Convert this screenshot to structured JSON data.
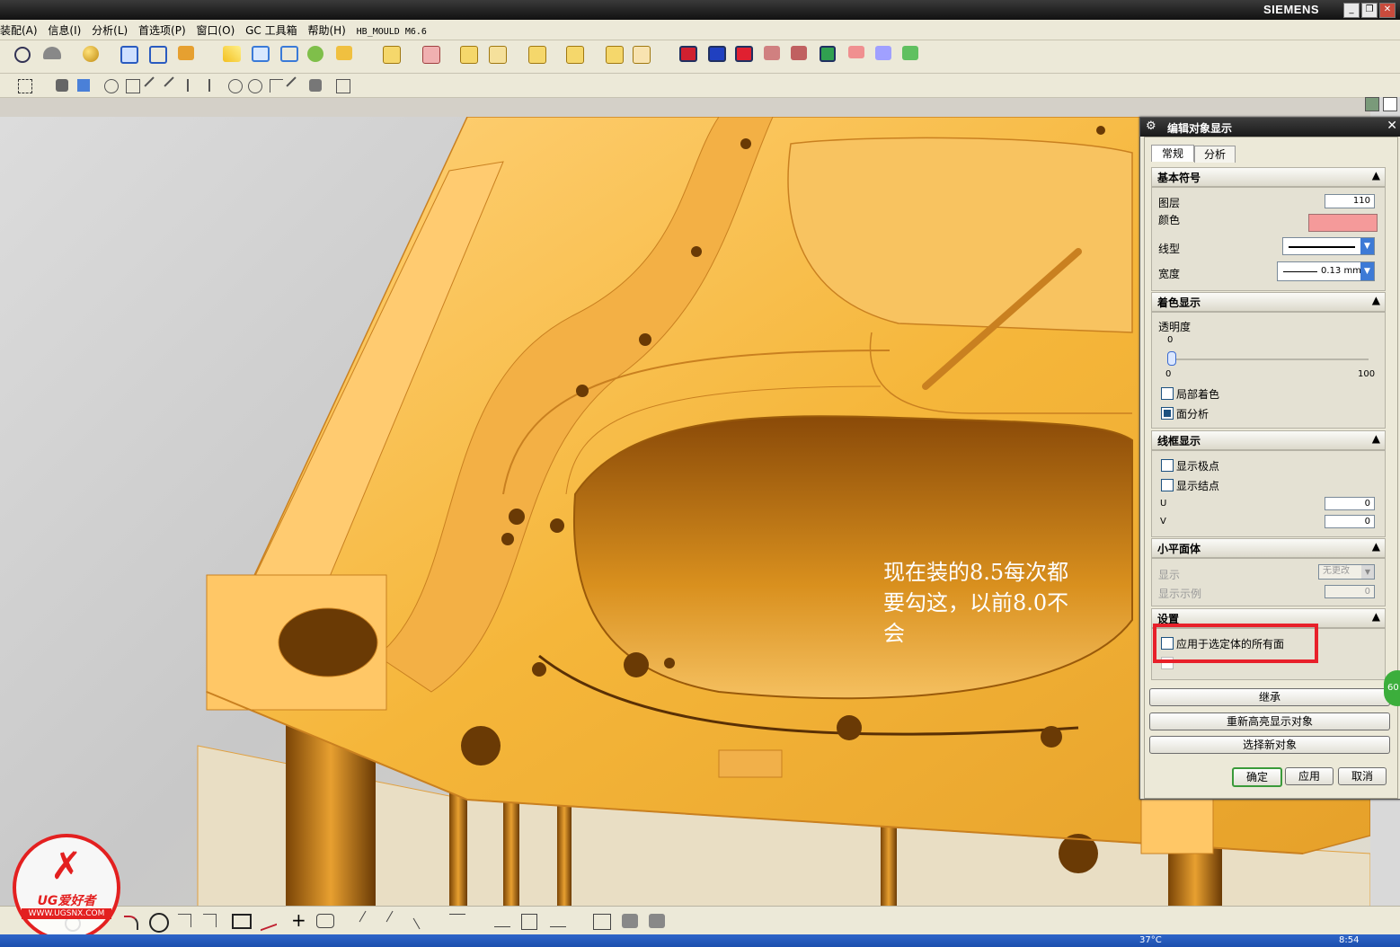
{
  "titlebar": {
    "brand": "SIEMENS"
  },
  "menu": {
    "items": [
      "装配(A)",
      "信息(I)",
      "分析(L)",
      "首选项(P)",
      "窗口(O)",
      "GC 工具箱",
      "帮助(H)",
      "HB_MOULD M6.6"
    ]
  },
  "annotation": {
    "line1": "现在装的8.5每次都",
    "line2": "要勾这，以前8.0不",
    "line3": "会"
  },
  "dialog": {
    "title": "编辑对象显示",
    "tabs": [
      "常规",
      "分析"
    ],
    "basic": {
      "header": "基本符号",
      "layer_label": "图层",
      "layer_value": "110",
      "color_label": "颜色",
      "color_value": "#f59a9a",
      "linetype_label": "线型",
      "width_label": "宽度",
      "width_value": "0.13 mm"
    },
    "shading": {
      "header": "着色显示",
      "transparency_label": "透明度",
      "transparency_value": "0",
      "slider_min": "0",
      "slider_max": "100",
      "partial_shading": "局部着色",
      "face_analysis": "面分析"
    },
    "wireframe": {
      "header": "线框显示",
      "show_poles": "显示极点",
      "show_knots": "显示结点",
      "u_label": "U",
      "u_value": "0",
      "v_label": "V",
      "v_value": "0"
    },
    "facets": {
      "header": "小平面体",
      "display_label": "显示",
      "display_value": "无更改",
      "example_label": "显示示例",
      "example_value": "0"
    },
    "settings": {
      "header": "设置",
      "apply_all_faces": "应用于选定体的所有面"
    },
    "buttons": {
      "inherit": "继承",
      "rehighlight": "重新高亮显示对象",
      "select_new": "选择新对象",
      "ok": "确定",
      "apply": "应用",
      "cancel": "取消"
    }
  },
  "watermark": {
    "brand": "UG爱好者",
    "url": "WWW.UGSNX.COM"
  },
  "side_badge": "60",
  "taskbar": {
    "temp": "37°C",
    "time": "8:54"
  },
  "colors": {
    "part": "#f6b63a",
    "part_edge": "#b87410",
    "accent_red": "#e8202a"
  }
}
